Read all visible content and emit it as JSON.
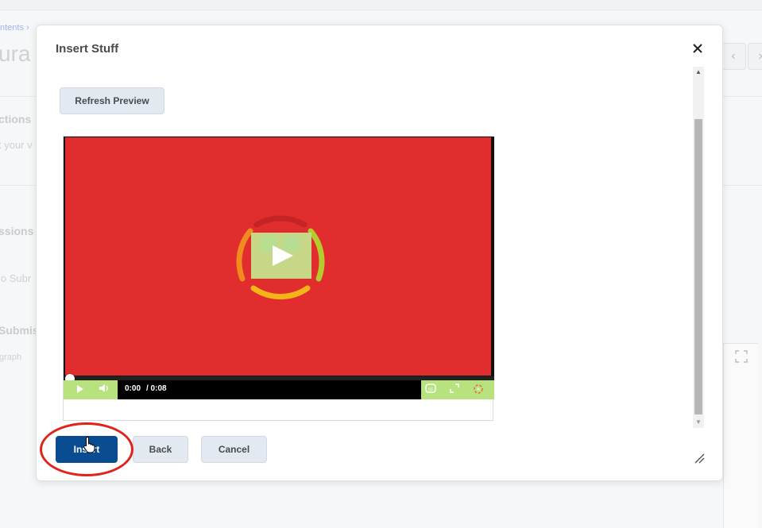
{
  "background": {
    "breadcrumb": "ntents ›",
    "title": "ura",
    "sections": [
      "ctions",
      "ssions",
      "Submis"
    ],
    "snippets": [
      "t your v",
      "lo Subr"
    ],
    "paragraph": "graph",
    "nav_prev_icon": "chevron-left-icon",
    "nav_next_icon": "chevron-right-icon"
  },
  "dialog": {
    "title": "Insert Stuff",
    "close_label": "×",
    "refresh_label": "Refresh Preview",
    "buttons": {
      "insert": "Insert",
      "back": "Back",
      "cancel": "Cancel"
    }
  },
  "player": {
    "current_time": "0:00",
    "total_time": "/ 0:08",
    "progress_fraction": 0.0,
    "accent_color": "#b7e27e",
    "video_bg_color": "#e12d2d"
  },
  "colors": {
    "primary_button": "#0a4c92",
    "secondary_button": "#e3e9f1",
    "highlight_ring": "#e0231c"
  }
}
